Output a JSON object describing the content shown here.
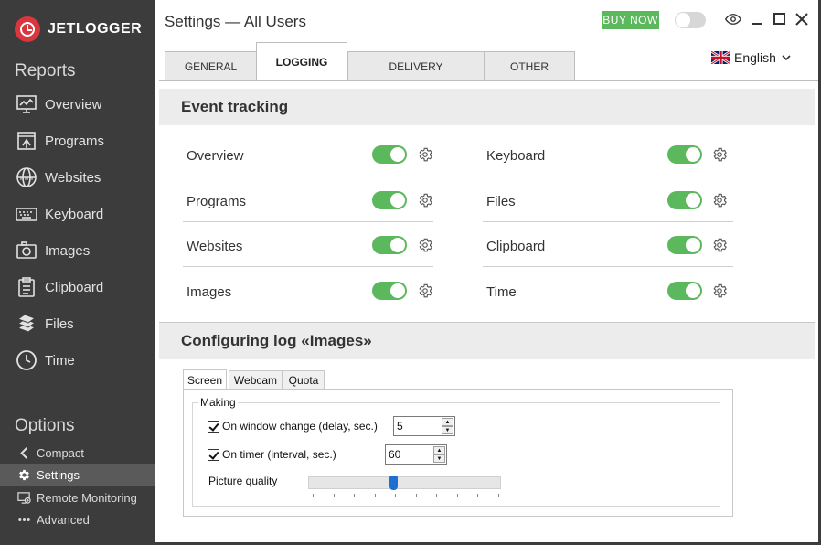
{
  "brand": {
    "name": "JETLOGGER",
    "color": "#d9363e"
  },
  "sidebar": {
    "reports_title": "Reports",
    "reports": [
      {
        "label": "Overview",
        "icon": "chart-board-icon"
      },
      {
        "label": "Programs",
        "icon": "programs-window-icon"
      },
      {
        "label": "Websites",
        "icon": "globe-www-icon"
      },
      {
        "label": "Keyboard",
        "icon": "keyboard-icon"
      },
      {
        "label": "Images",
        "icon": "camera-icon"
      },
      {
        "label": "Clipboard",
        "icon": "clipboard-icon"
      },
      {
        "label": "Files",
        "icon": "files-stack-icon"
      },
      {
        "label": "Time",
        "icon": "clock-icon"
      }
    ],
    "options_title": "Options",
    "options": [
      {
        "label": "Compact",
        "icon": "chevron-left-icon",
        "active": false
      },
      {
        "label": "Settings",
        "icon": "gear-icon",
        "active": true
      },
      {
        "label": "Remote Monitoring",
        "icon": "remote-monitor-icon",
        "active": false
      },
      {
        "label": "Advanced",
        "icon": "more-dots-icon",
        "active": false
      }
    ]
  },
  "header": {
    "title": "Settings — All Users",
    "buy_now": "BUY NOW",
    "accent_color": "#5cb85c"
  },
  "tabs": [
    {
      "label": "GENERAL",
      "active": false
    },
    {
      "label": "LOGGING",
      "active": true
    },
    {
      "label": "DELIVERY",
      "active": false
    },
    {
      "label": "OTHER",
      "active": false
    }
  ],
  "language": {
    "selected": "English",
    "flag": "uk-flag-icon"
  },
  "event_tracking": {
    "title": "Event tracking",
    "left": [
      {
        "label": "Overview",
        "enabled": true
      },
      {
        "label": "Programs",
        "enabled": true
      },
      {
        "label": "Websites",
        "enabled": true
      },
      {
        "label": "Images",
        "enabled": true
      }
    ],
    "right": [
      {
        "label": "Keyboard",
        "enabled": true
      },
      {
        "label": "Files",
        "enabled": true
      },
      {
        "label": "Clipboard",
        "enabled": true
      },
      {
        "label": "Time",
        "enabled": true
      }
    ]
  },
  "config": {
    "title": "Configuring log «Images»",
    "tabs": [
      "Screen",
      "Webcam",
      "Quota"
    ],
    "active_tab": "Screen",
    "group_title": "Making",
    "on_window_change": {
      "label": "On window change (delay, sec.)",
      "checked": true,
      "value": "5"
    },
    "on_timer": {
      "label": "On timer (interval, sec.)",
      "checked": true,
      "value": "60"
    },
    "picture_quality": {
      "label": "Picture quality",
      "level": 0.44
    }
  }
}
